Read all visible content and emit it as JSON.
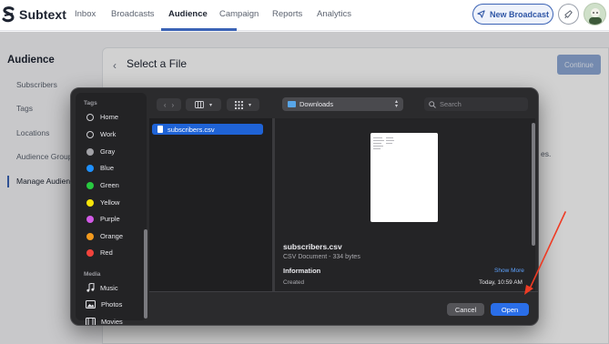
{
  "app": {
    "logo_text": "Subtext"
  },
  "nav": {
    "tabs": [
      {
        "label": "Inbox"
      },
      {
        "label": "Broadcasts"
      },
      {
        "label": "Audience",
        "active": true
      },
      {
        "label": "Campaign"
      },
      {
        "label": "Reports"
      },
      {
        "label": "Analytics"
      }
    ],
    "new_broadcast": "New Broadcast"
  },
  "sidebar": {
    "title": "Audience",
    "items": [
      {
        "label": "Subscribers"
      },
      {
        "label": "Tags"
      },
      {
        "label": "Locations"
      },
      {
        "label": "Audience Group"
      },
      {
        "label": "Manage Audien",
        "active": true
      }
    ]
  },
  "panel": {
    "title": "Select a File",
    "continue_label": "Continue",
    "obscured_text": "es."
  },
  "dialog": {
    "tags_header": "Tags",
    "tags": [
      {
        "label": "Home",
        "color": "hollow"
      },
      {
        "label": "Work",
        "color": "hollow"
      },
      {
        "label": "Gray",
        "color": "#a1a1a6"
      },
      {
        "label": "Blue",
        "color": "#1e90ff"
      },
      {
        "label": "Green",
        "color": "#28c940"
      },
      {
        "label": "Yellow",
        "color": "#f6e40a"
      },
      {
        "label": "Purple",
        "color": "#d25ae6"
      },
      {
        "label": "Orange",
        "color": "#f39a1e"
      },
      {
        "label": "Red",
        "color": "#f2433c"
      }
    ],
    "media_header": "Media",
    "media": [
      {
        "label": "Music",
        "icon": "music-note-icon"
      },
      {
        "label": "Photos",
        "icon": "photos-icon"
      },
      {
        "label": "Movies",
        "icon": "film-icon"
      }
    ],
    "location": "Downloads",
    "search_placeholder": "Search",
    "selected_file": "subscribers.csv",
    "preview": {
      "name": "subscribers.csv",
      "type": "CSV Document - 334 bytes",
      "info_title": "Information",
      "show_more": "Show More",
      "created_label": "Created",
      "created_value": "Today, 10:59 AM"
    },
    "cancel_label": "Cancel",
    "open_label": "Open"
  },
  "colors": {
    "accent": "#3b63b5",
    "open_button": "#2a6ee8",
    "annotation": "#ee3b24"
  }
}
